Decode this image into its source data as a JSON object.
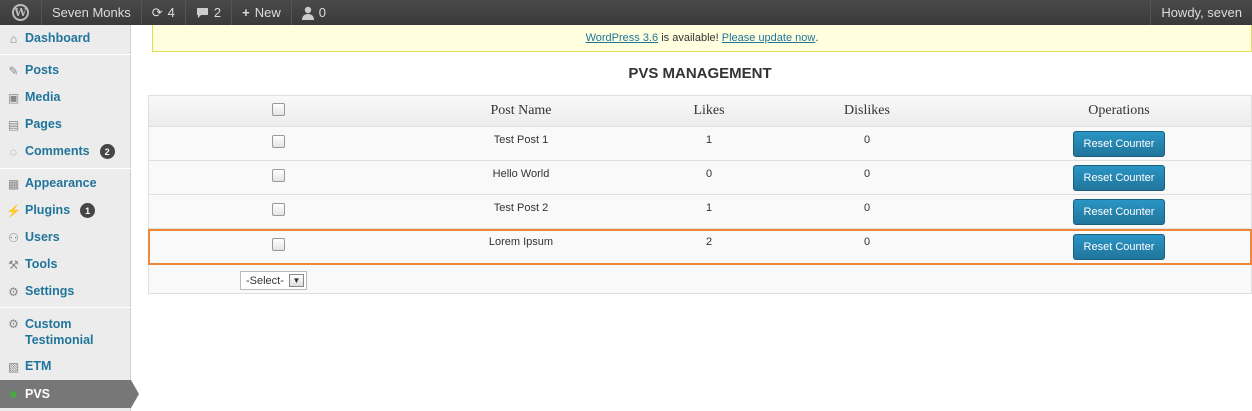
{
  "adminbar": {
    "site_name": "Seven Monks",
    "updates_count": "4",
    "comments_count": "2",
    "new_label": "New",
    "pending_count": "0",
    "howdy": "Howdy, seven"
  },
  "sidebar": {
    "dashboard": "Dashboard",
    "posts": "Posts",
    "media": "Media",
    "pages": "Pages",
    "comments": "Comments",
    "comments_badge": "2",
    "appearance": "Appearance",
    "plugins": "Plugins",
    "plugins_badge": "1",
    "users": "Users",
    "tools": "Tools",
    "settings": "Settings",
    "custom_testimonial": "Custom Testimonial",
    "etm": "ETM",
    "pvs": "PVS"
  },
  "notice": {
    "link_version": "WordPress 3.6",
    "middle_text": " is available! ",
    "link_update": "Please update now",
    "end": "."
  },
  "page_title": "PVS MANAGEMENT",
  "table": {
    "headers": {
      "post_name": "Post Name",
      "likes": "Likes",
      "dislikes": "Dislikes",
      "operations": "Operations"
    },
    "button_label": "Reset Counter",
    "rows": [
      {
        "post_name": "Test Post 1",
        "likes": "1",
        "dislikes": "0"
      },
      {
        "post_name": "Hello World",
        "likes": "0",
        "dislikes": "0"
      },
      {
        "post_name": "Test Post 2",
        "likes": "1",
        "dislikes": "0"
      },
      {
        "post_name": "Lorem Ipsum",
        "likes": "2",
        "dislikes": "0"
      }
    ]
  },
  "bulk_select": {
    "selected": "-Select-"
  },
  "colors": {
    "highlight": "#f0883c",
    "button": "#21759b",
    "link": "#21759b"
  }
}
